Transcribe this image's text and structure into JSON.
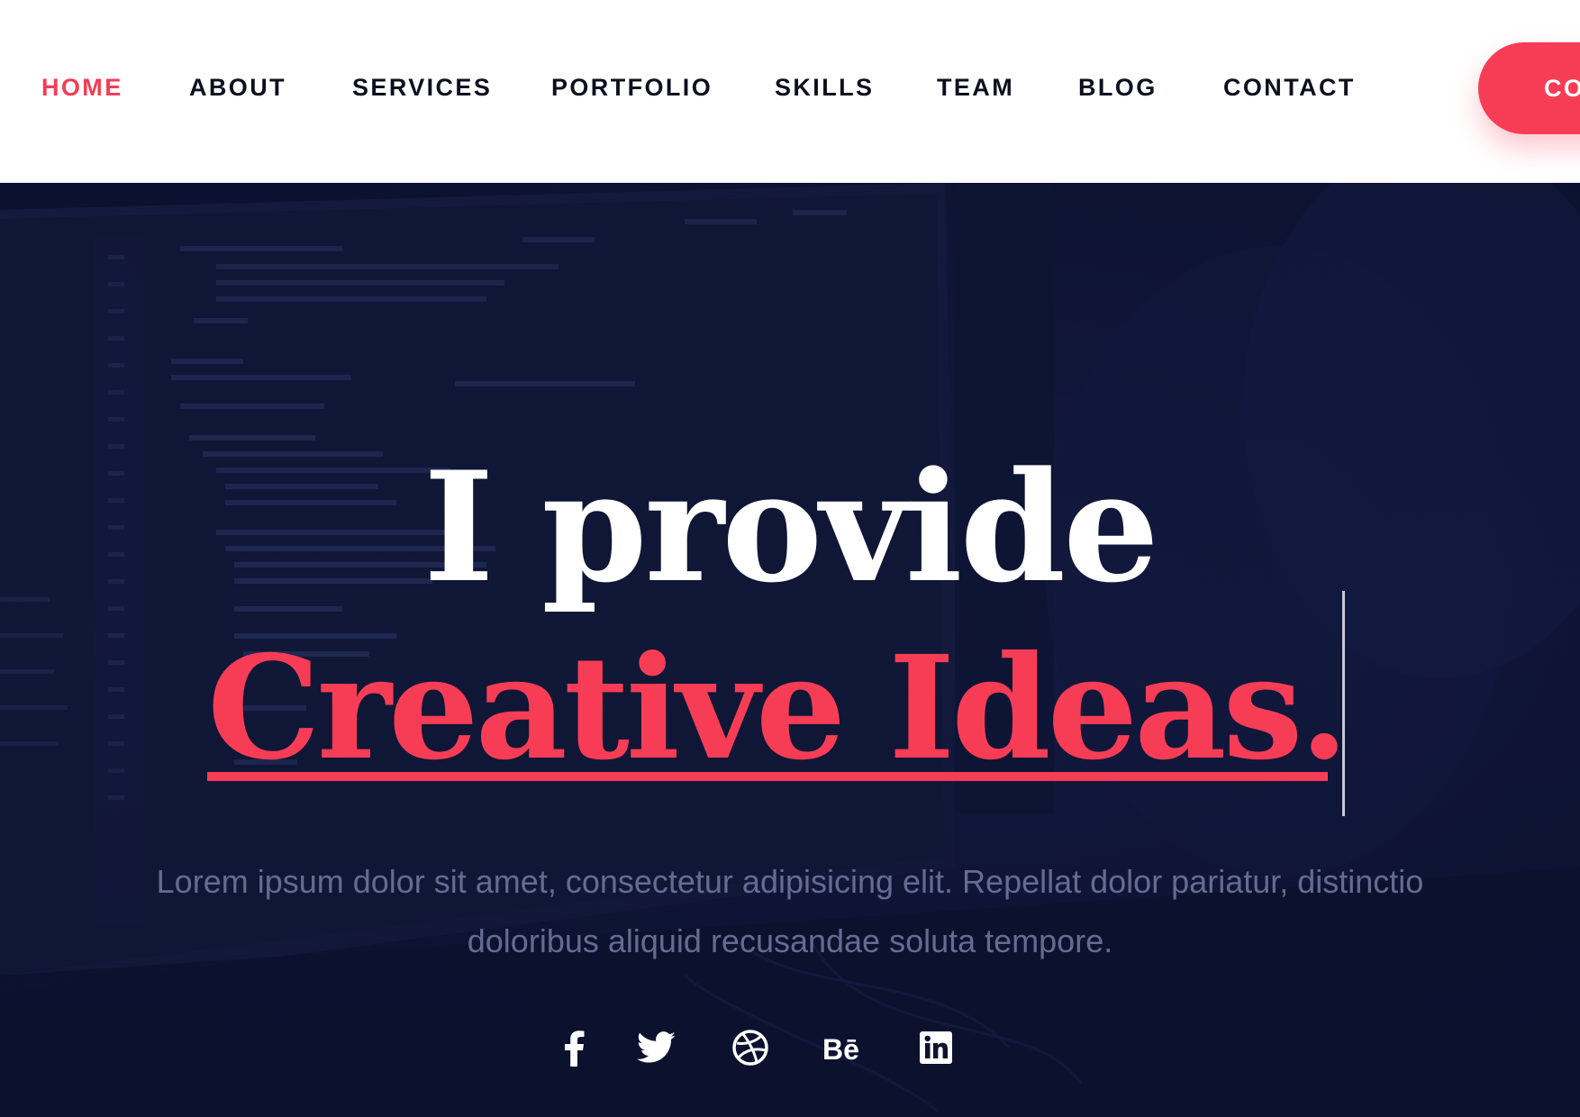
{
  "nav": {
    "items": [
      {
        "label": "HOME",
        "active": true
      },
      {
        "label": "ABOUT",
        "active": false
      },
      {
        "label": "SERVICES",
        "active": false
      },
      {
        "label": "PORTFOLIO",
        "active": false
      },
      {
        "label": "SKILLS",
        "active": false
      },
      {
        "label": "TEAM",
        "active": false
      },
      {
        "label": "BLOG",
        "active": false
      },
      {
        "label": "CONTACT",
        "active": false
      }
    ],
    "cta_label": "CO"
  },
  "hero": {
    "headline_line1": "I provide",
    "headline_line2": "Creative Ideas.",
    "description": "Lorem ipsum dolor sit amet, consectetur adipisicing elit. Repellat dolor pariatur, distinctio doloribus aliquid recusandae soluta tempore.",
    "social_icons": [
      "facebook-icon",
      "twitter-icon",
      "dribbble-icon",
      "behance-icon",
      "linkedin-icon"
    ]
  },
  "colors": {
    "accent": "#f73d55",
    "nav_text": "#0c0f1e",
    "hero_bg": "#0d1232",
    "description_text": "#646c92",
    "headline_white": "#ffffff"
  }
}
